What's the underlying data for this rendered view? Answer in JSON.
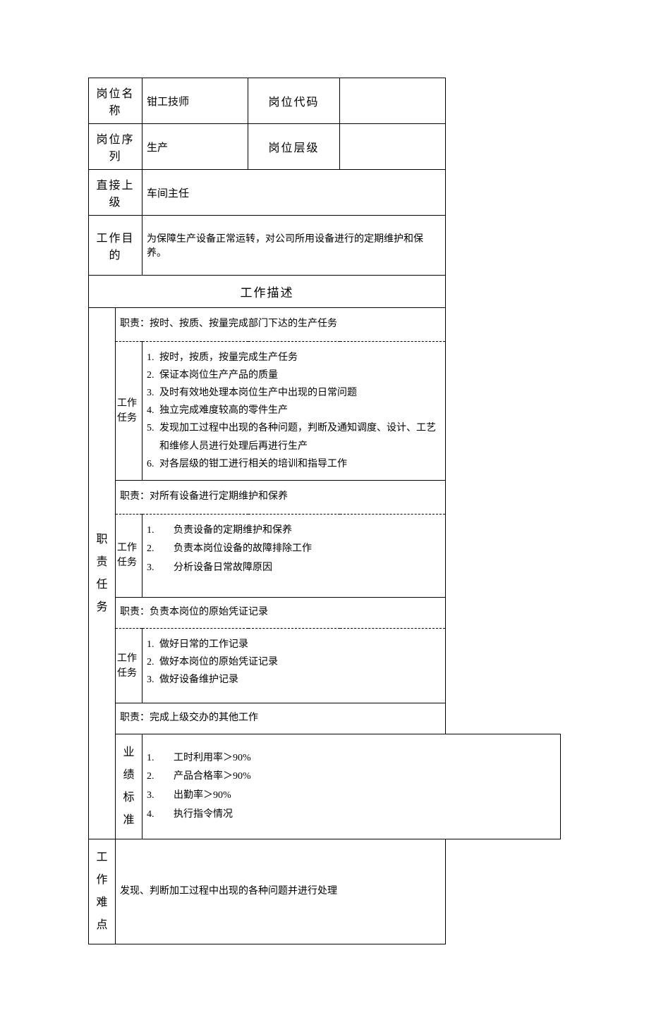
{
  "header": {
    "positionName_label": "岗位名称",
    "positionName_value": "钳工技师",
    "positionCode_label": "岗位代码",
    "positionCode_value": "",
    "positionSeries_label": "岗位序列",
    "positionSeries_value": "生产",
    "positionLevel_label": "岗位层级",
    "positionLevel_value": "",
    "directSupervisor_label": "直接上级",
    "directSupervisor_value": "车间主任",
    "workPurpose_label": "工作目的",
    "workPurpose_value": "为保障生产设备正常运转，对公司所用设备进行的定期维护和保养。"
  },
  "sectionTitle": "工作描述",
  "dutiesLabel": "职责任务",
  "taskLabel": "工作任务",
  "duties": [
    {
      "title": "职责：按时、按质、按量完成部门下达的生产任务",
      "tasks": [
        "按时，按质，按量完成生产任务",
        "保证本岗位生产产品的质量",
        "及时有效地处理本岗位生产中出现的日常问题",
        "独立完成难度较高的零件生产",
        "发现加工过程中出现的各种问题，判断及通知调度、设计、工艺和维修人员进行处理后再进行生产",
        "对各层级的钳工进行相关的培训和指导工作"
      ]
    },
    {
      "title": "职责：对所有设备进行定期维护和保养",
      "tasks": [
        "负责设备的定期维护和保养",
        "负责本岗位设备的故障排除工作",
        "分析设备日常故障原因"
      ]
    },
    {
      "title": "职责：负责本岗位的原始凭证记录",
      "tasks": [
        "做好日常的工作记录",
        "做好本岗位的原始凭证记录",
        "做好设备维护记录"
      ]
    },
    {
      "title": "职责：完成上级交办的其他工作"
    }
  ],
  "performanceLabel": "业绩标准",
  "performance": [
    "工时利用率＞90%",
    "产品合格率＞90%",
    "出勤率＞90%",
    "执行指令情况"
  ],
  "difficultyLabel": "工作难点",
  "difficulty": "发现、判断加工过程中出现的各种问题并进行处理"
}
